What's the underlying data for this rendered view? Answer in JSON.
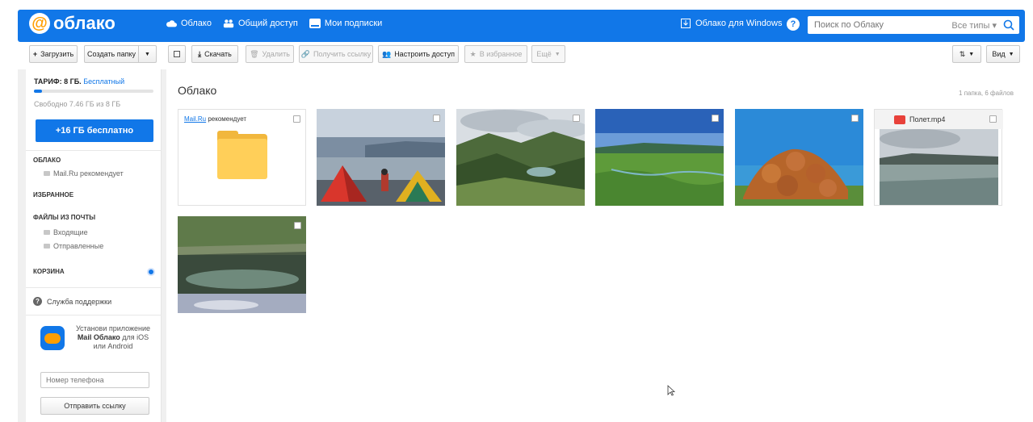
{
  "header": {
    "logo": "облако",
    "nav": [
      "Облако",
      "Общий доступ",
      "Мои подписки"
    ],
    "windows_link": "Облако для Windows",
    "help_label": "?",
    "search_placeholder": "Поиск по Облаку",
    "search_types": "Все типы"
  },
  "toolbar": {
    "upload": "Загрузить",
    "create_folder": "Создать папку",
    "download": "Скачать",
    "delete": "Удалить",
    "get_link": "Получить ссылку",
    "share": "Настроить доступ",
    "favorite": "В избранное",
    "more": "Ещё",
    "view": "Вид"
  },
  "sidebar": {
    "tariff_label": "ТАРИФ: 8 ГБ.",
    "tariff_plan": "Бесплатный",
    "quota_fraction": 0.07,
    "free_space": "Свободно 7.46 ГБ из 8 ГБ",
    "upgrade_button": "+16 ГБ бесплатно",
    "section_cloud": "ОБЛАКО",
    "cloud_items": [
      "Mail.Ru рекомендует"
    ],
    "section_favorites": "ИЗБРАННОЕ",
    "section_mail": "ФАЙЛЫ ИЗ ПОЧТЫ",
    "mail_items": [
      "Входящие",
      "Отправленные"
    ],
    "section_trash": "КОРЗИНА",
    "support": "Служба поддержки",
    "app_promo_1": "Установи приложение",
    "app_promo_bold": "Mail Облако",
    "app_promo_2": "для iOS или Android",
    "phone_placeholder": "Номер телефона",
    "send_button": "Отправить ссылку"
  },
  "main": {
    "breadcrumb": "Облако",
    "count": "1 папка, 6 файлов",
    "folder_prefix": "Mail.Ru",
    "folder_suffix": "рекомендует",
    "video_name": "Полет.mp4"
  }
}
